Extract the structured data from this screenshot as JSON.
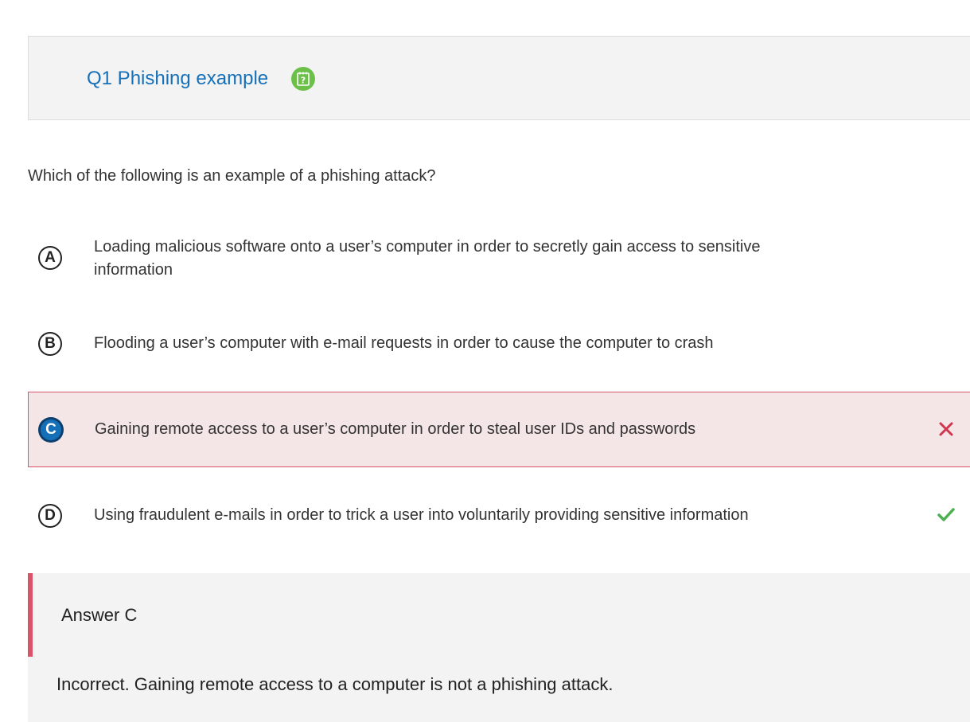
{
  "header": {
    "title": "Q1 Phishing example",
    "help_icon": "question-notepad-icon",
    "help_icon_color": "#6cc04a",
    "title_color": "#1670b8"
  },
  "question": {
    "text": "Which of the following is an example of a phishing attack?"
  },
  "options": [
    {
      "letter": "A",
      "text": "Loading malicious software onto a user’s computer in order to secretly gain access to sensitive information",
      "selected": false,
      "status": ""
    },
    {
      "letter": "B",
      "text": "Flooding a user’s computer with e-mail requests in order to cause the computer to crash",
      "selected": false,
      "status": ""
    },
    {
      "letter": "C",
      "text": "Gaining remote access to a user’s computer in order to steal user IDs and passwords",
      "selected": true,
      "status": "incorrect",
      "status_icon": "cross-icon",
      "status_color": "#d0364f"
    },
    {
      "letter": "D",
      "text": "Using fraudulent e-mails in order to trick a user into voluntarily providing sensitive information",
      "selected": false,
      "status": "correct",
      "status_icon": "check-icon",
      "status_color": "#4caf50"
    }
  ],
  "feedback": {
    "answer_label": "Answer C",
    "text": "Incorrect. Gaining remote access to a computer is not a phishing attack.",
    "accent_color": "#d9536b"
  }
}
